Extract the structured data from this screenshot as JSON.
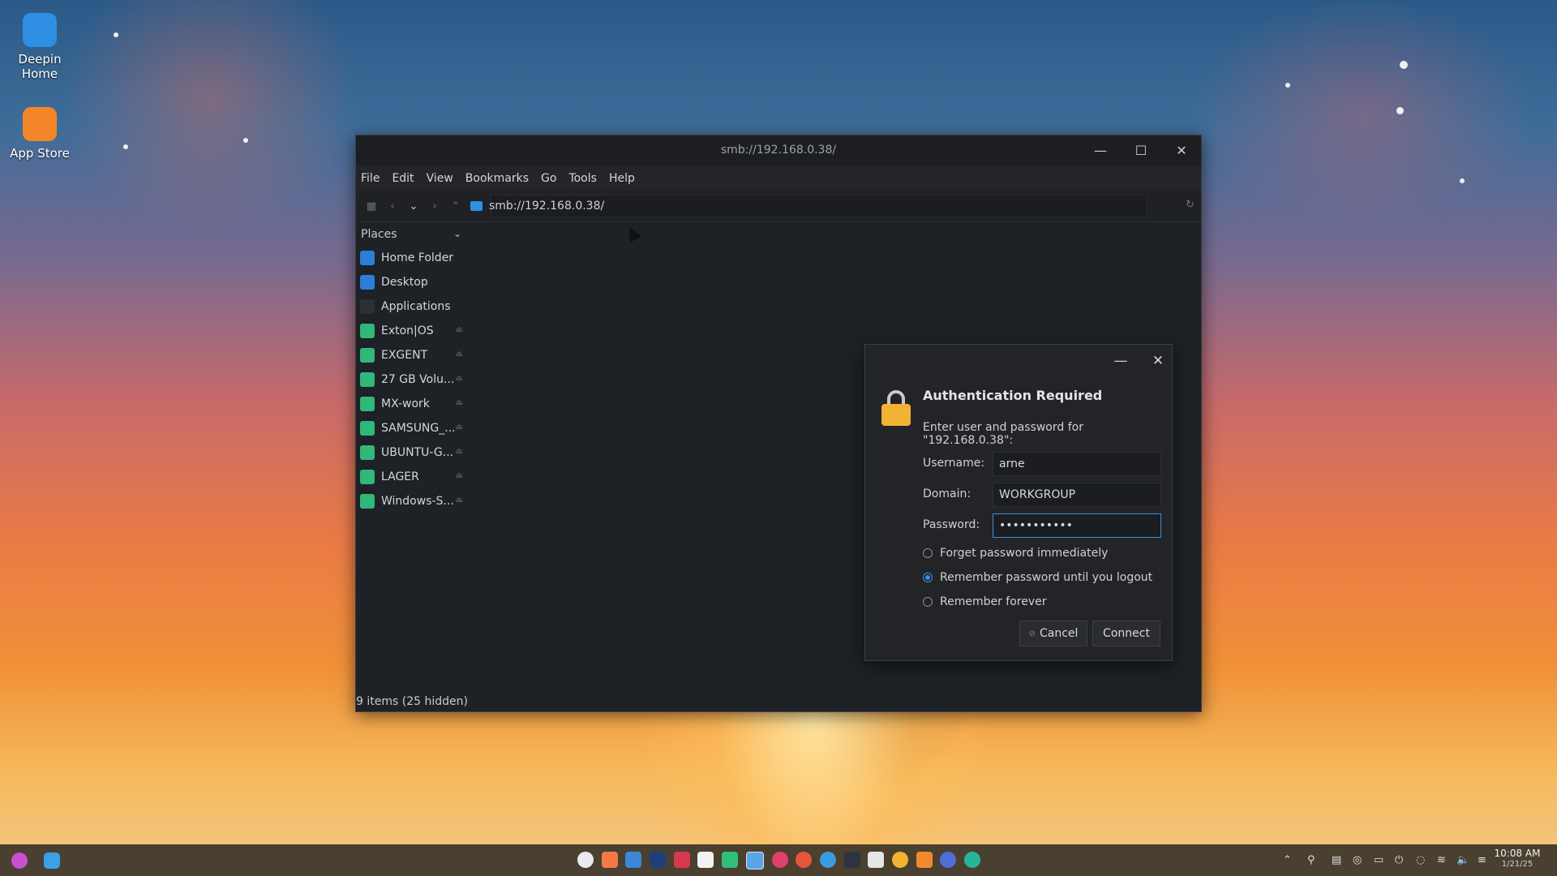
{
  "desktop": {
    "icons": [
      {
        "label": "Deepin Home",
        "icon": "deepin-home-icon"
      },
      {
        "label": "App Store",
        "icon": "app-store-icon"
      }
    ]
  },
  "window": {
    "title": "smb://192.168.0.38/",
    "menu": [
      "File",
      "Edit",
      "View",
      "Bookmarks",
      "Go",
      "Tools",
      "Help"
    ],
    "location": "smb://192.168.0.38/",
    "sidebar": {
      "header": "Places",
      "items": [
        {
          "label": "Home Folder",
          "icon": "home-folder-icon"
        },
        {
          "label": "Desktop",
          "icon": "desktop-folder-icon"
        },
        {
          "label": "Applications",
          "icon": "applications-icon"
        },
        {
          "label": "Exton|OS",
          "icon": "drive-icon"
        },
        {
          "label": "EXGENT",
          "icon": "drive-icon"
        },
        {
          "label": "27 GB Volu...",
          "icon": "drive-icon"
        },
        {
          "label": "MX-work",
          "icon": "drive-icon"
        },
        {
          "label": "SAMSUNG_...",
          "icon": "drive-icon"
        },
        {
          "label": "UBUNTU-G...",
          "icon": "drive-icon"
        },
        {
          "label": "LAGER",
          "icon": "drive-icon"
        },
        {
          "label": "Windows-S...",
          "icon": "drive-icon"
        }
      ]
    },
    "status": "9 items (25 hidden)"
  },
  "dialog": {
    "title": "Authentication Required",
    "prompt": "Enter user and password for \"192.168.0.38\":",
    "username_label": "Username:",
    "username_value": "arne",
    "domain_label": "Domain:",
    "domain_value": "WORKGROUP",
    "password_label": "Password:",
    "password_value": "•••••••••••",
    "options": [
      {
        "label": "Forget password immediately",
        "selected": false
      },
      {
        "label": "Remember password until you logout",
        "selected": true
      },
      {
        "label": "Remember forever",
        "selected": false
      }
    ],
    "cancel_label": "Cancel",
    "connect_label": "Connect"
  },
  "taskbar": {
    "time": "10:08 AM",
    "date": "1/21/25"
  },
  "colors": {
    "accent": "#3d8fe0",
    "window_bg": "#1e2126",
    "drive_green": "#2fb87a",
    "folder_blue": "#2b7fd8"
  }
}
